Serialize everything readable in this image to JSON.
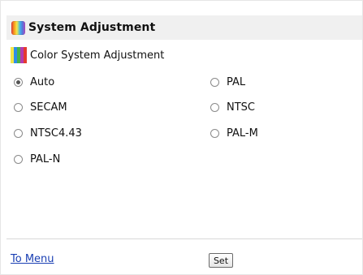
{
  "header": {
    "title": "System Adjustment",
    "icon": "color-gradient-icon"
  },
  "section": {
    "label": "Color System Adjustment",
    "icon": "color-bars-icon",
    "bar_colors": [
      "#f3e64a",
      "#2d8ee8",
      "#45b24a",
      "#b43bb1",
      "#e43b2f"
    ]
  },
  "options": {
    "auto": "Auto",
    "pal": "PAL",
    "secam": "SECAM",
    "ntsc": "NTSC",
    "ntsc443": "NTSC4.43",
    "palm": "PAL-M",
    "paln": "PAL-N",
    "selected": "Auto"
  },
  "footer": {
    "menu_link": "To Menu",
    "set_button": "Set"
  }
}
